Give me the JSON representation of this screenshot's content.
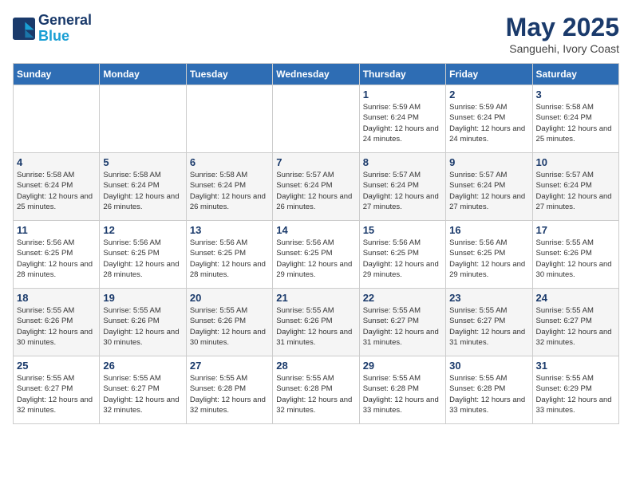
{
  "header": {
    "logo_line1": "General",
    "logo_line2": "Blue",
    "month": "May 2025",
    "location": "Sanguehi, Ivory Coast"
  },
  "days_of_week": [
    "Sunday",
    "Monday",
    "Tuesday",
    "Wednesday",
    "Thursday",
    "Friday",
    "Saturday"
  ],
  "weeks": [
    [
      {
        "day": "",
        "info": ""
      },
      {
        "day": "",
        "info": ""
      },
      {
        "day": "",
        "info": ""
      },
      {
        "day": "",
        "info": ""
      },
      {
        "day": "1",
        "info": "Sunrise: 5:59 AM\nSunset: 6:24 PM\nDaylight: 12 hours and 24 minutes."
      },
      {
        "day": "2",
        "info": "Sunrise: 5:59 AM\nSunset: 6:24 PM\nDaylight: 12 hours and 24 minutes."
      },
      {
        "day": "3",
        "info": "Sunrise: 5:58 AM\nSunset: 6:24 PM\nDaylight: 12 hours and 25 minutes."
      }
    ],
    [
      {
        "day": "4",
        "info": "Sunrise: 5:58 AM\nSunset: 6:24 PM\nDaylight: 12 hours and 25 minutes."
      },
      {
        "day": "5",
        "info": "Sunrise: 5:58 AM\nSunset: 6:24 PM\nDaylight: 12 hours and 26 minutes."
      },
      {
        "day": "6",
        "info": "Sunrise: 5:58 AM\nSunset: 6:24 PM\nDaylight: 12 hours and 26 minutes."
      },
      {
        "day": "7",
        "info": "Sunrise: 5:57 AM\nSunset: 6:24 PM\nDaylight: 12 hours and 26 minutes."
      },
      {
        "day": "8",
        "info": "Sunrise: 5:57 AM\nSunset: 6:24 PM\nDaylight: 12 hours and 27 minutes."
      },
      {
        "day": "9",
        "info": "Sunrise: 5:57 AM\nSunset: 6:24 PM\nDaylight: 12 hours and 27 minutes."
      },
      {
        "day": "10",
        "info": "Sunrise: 5:57 AM\nSunset: 6:24 PM\nDaylight: 12 hours and 27 minutes."
      }
    ],
    [
      {
        "day": "11",
        "info": "Sunrise: 5:56 AM\nSunset: 6:25 PM\nDaylight: 12 hours and 28 minutes."
      },
      {
        "day": "12",
        "info": "Sunrise: 5:56 AM\nSunset: 6:25 PM\nDaylight: 12 hours and 28 minutes."
      },
      {
        "day": "13",
        "info": "Sunrise: 5:56 AM\nSunset: 6:25 PM\nDaylight: 12 hours and 28 minutes."
      },
      {
        "day": "14",
        "info": "Sunrise: 5:56 AM\nSunset: 6:25 PM\nDaylight: 12 hours and 29 minutes."
      },
      {
        "day": "15",
        "info": "Sunrise: 5:56 AM\nSunset: 6:25 PM\nDaylight: 12 hours and 29 minutes."
      },
      {
        "day": "16",
        "info": "Sunrise: 5:56 AM\nSunset: 6:25 PM\nDaylight: 12 hours and 29 minutes."
      },
      {
        "day": "17",
        "info": "Sunrise: 5:55 AM\nSunset: 6:26 PM\nDaylight: 12 hours and 30 minutes."
      }
    ],
    [
      {
        "day": "18",
        "info": "Sunrise: 5:55 AM\nSunset: 6:26 PM\nDaylight: 12 hours and 30 minutes."
      },
      {
        "day": "19",
        "info": "Sunrise: 5:55 AM\nSunset: 6:26 PM\nDaylight: 12 hours and 30 minutes."
      },
      {
        "day": "20",
        "info": "Sunrise: 5:55 AM\nSunset: 6:26 PM\nDaylight: 12 hours and 30 minutes."
      },
      {
        "day": "21",
        "info": "Sunrise: 5:55 AM\nSunset: 6:26 PM\nDaylight: 12 hours and 31 minutes."
      },
      {
        "day": "22",
        "info": "Sunrise: 5:55 AM\nSunset: 6:27 PM\nDaylight: 12 hours and 31 minutes."
      },
      {
        "day": "23",
        "info": "Sunrise: 5:55 AM\nSunset: 6:27 PM\nDaylight: 12 hours and 31 minutes."
      },
      {
        "day": "24",
        "info": "Sunrise: 5:55 AM\nSunset: 6:27 PM\nDaylight: 12 hours and 32 minutes."
      }
    ],
    [
      {
        "day": "25",
        "info": "Sunrise: 5:55 AM\nSunset: 6:27 PM\nDaylight: 12 hours and 32 minutes."
      },
      {
        "day": "26",
        "info": "Sunrise: 5:55 AM\nSunset: 6:27 PM\nDaylight: 12 hours and 32 minutes."
      },
      {
        "day": "27",
        "info": "Sunrise: 5:55 AM\nSunset: 6:28 PM\nDaylight: 12 hours and 32 minutes."
      },
      {
        "day": "28",
        "info": "Sunrise: 5:55 AM\nSunset: 6:28 PM\nDaylight: 12 hours and 32 minutes."
      },
      {
        "day": "29",
        "info": "Sunrise: 5:55 AM\nSunset: 6:28 PM\nDaylight: 12 hours and 33 minutes."
      },
      {
        "day": "30",
        "info": "Sunrise: 5:55 AM\nSunset: 6:28 PM\nDaylight: 12 hours and 33 minutes."
      },
      {
        "day": "31",
        "info": "Sunrise: 5:55 AM\nSunset: 6:29 PM\nDaylight: 12 hours and 33 minutes."
      }
    ]
  ]
}
